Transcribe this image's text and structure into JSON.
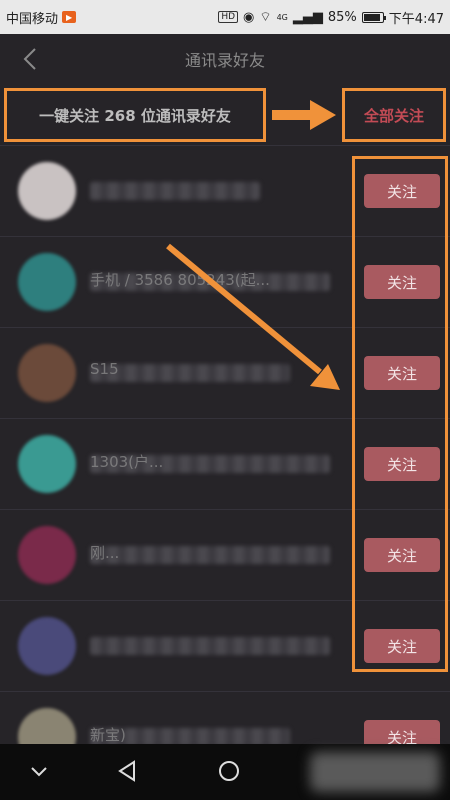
{
  "status_bar": {
    "carrier": "中国移动",
    "hd": "HD",
    "network": "4G",
    "battery": "85%",
    "time": "下午4:47"
  },
  "header": {
    "title": "通讯录好友",
    "back_icon": "chevron-left-icon"
  },
  "follow_bar": {
    "summary": "一键关注 268 位通讯录好友",
    "follow_all_label": "全部关注"
  },
  "contacts": [
    {
      "name_visible": "",
      "follow_label": "关注",
      "avatar_color": "#c9c2c2"
    },
    {
      "name_visible": "手机 / 3586 805243(起...",
      "follow_label": "关注",
      "avatar_color": "#2e7f7e"
    },
    {
      "name_visible": "S15",
      "follow_label": "关注",
      "avatar_color": "#6b4a3a"
    },
    {
      "name_visible": "1303(户...",
      "follow_label": "关注",
      "avatar_color": "#3a9a92"
    },
    {
      "name_visible": "刚...",
      "follow_label": "关注",
      "avatar_color": "#7a2a4a"
    },
    {
      "name_visible": "",
      "follow_label": "关注",
      "avatar_color": "#4a4a7a"
    },
    {
      "name_visible": "新宝)",
      "follow_label": "关注",
      "avatar_color": "#8a8472"
    }
  ],
  "colors": {
    "background": "#262428",
    "accent_annotation": "#f0923a",
    "follow_button": "#a95a60",
    "follow_all_text": "#c24b55"
  }
}
